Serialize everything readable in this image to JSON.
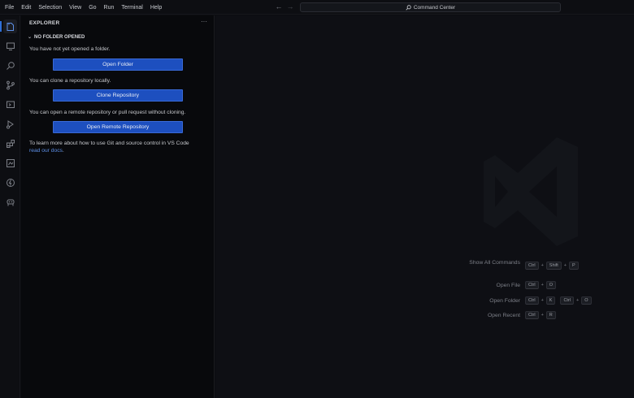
{
  "menu": [
    "File",
    "Edit",
    "Selection",
    "View",
    "Go",
    "Run",
    "Terminal",
    "Help"
  ],
  "command_center": {
    "label": "Command Center",
    "icon": "search-icon"
  },
  "activity_bar": [
    "explorer-icon",
    "remote-explorer-icon",
    "search-icon",
    "source-control-icon",
    "run-debug-icon",
    "extensions-icon",
    "testing-icon",
    "lightning-icon",
    "copilot-icon"
  ],
  "sidebar": {
    "title": "EXPLORER",
    "more": "···",
    "section": "NO FOLDER OPENED",
    "text_open": "You have not yet opened a folder.",
    "btn_open_folder": "Open Folder",
    "text_clone": "You can clone a repository locally.",
    "btn_clone": "Clone Repository",
    "text_remote": "You can open a remote repository or pull request without cloning.",
    "btn_remote": "Open Remote Repository",
    "text_learn": "To learn more about how to use Git and source control in VS Code",
    "link_docs": "read our docs",
    "text_end": "."
  },
  "shortcuts": [
    {
      "label": "Show All Commands",
      "keys": [
        [
          "Ctrl",
          "Shift",
          "P"
        ]
      ]
    },
    {
      "label": "Open File",
      "keys": [
        [
          "Ctrl",
          "O"
        ]
      ]
    },
    {
      "label": "Open Folder",
      "keys": [
        [
          "Ctrl",
          "K"
        ],
        [
          "Ctrl",
          "O"
        ]
      ]
    },
    {
      "label": "Open Recent",
      "keys": [
        [
          "Ctrl",
          "R"
        ]
      ]
    }
  ],
  "colors": {
    "accent": "#2f6fd8",
    "button": "#1d4fbf",
    "link": "#5d8fe6"
  }
}
